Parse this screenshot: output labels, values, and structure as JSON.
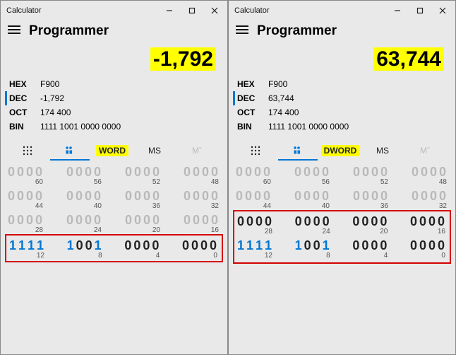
{
  "windows": [
    {
      "title": "Calculator",
      "mode": "Programmer",
      "result": "-1,792",
      "bases": [
        {
          "key": "HEX",
          "val": "F900",
          "sel": false
        },
        {
          "key": "DEC",
          "val": "-1,792",
          "sel": true
        },
        {
          "key": "OCT",
          "val": "174 400",
          "sel": false
        },
        {
          "key": "BIN",
          "val": "1111 1001 0000 0000",
          "sel": false
        }
      ],
      "word_label": "WORD",
      "ms_label": "MS",
      "mclear": "Mˇ",
      "rows": [
        {
          "nibbles": [
            {
              "bits": "0000",
              "pos": "60",
              "active": false
            },
            {
              "bits": "0000",
              "pos": "56",
              "active": false
            },
            {
              "bits": "0000",
              "pos": "52",
              "active": false
            },
            {
              "bits": "0000",
              "pos": "48",
              "active": false
            }
          ],
          "box": false
        },
        {
          "nibbles": [
            {
              "bits": "0000",
              "pos": "44",
              "active": false
            },
            {
              "bits": "0000",
              "pos": "40",
              "active": false
            },
            {
              "bits": "0000",
              "pos": "36",
              "active": false
            },
            {
              "bits": "0000",
              "pos": "32",
              "active": false
            }
          ],
          "box": false
        },
        {
          "nibbles": [
            {
              "bits": "0000",
              "pos": "28",
              "active": false
            },
            {
              "bits": "0000",
              "pos": "24",
              "active": false
            },
            {
              "bits": "0000",
              "pos": "20",
              "active": false
            },
            {
              "bits": "0000",
              "pos": "16",
              "active": false
            }
          ],
          "box": false
        },
        {
          "nibbles": [
            {
              "bits": "1111",
              "pos": "12",
              "active": true
            },
            {
              "bits": "1001",
              "pos": "8",
              "active": true
            },
            {
              "bits": "0000",
              "pos": "4",
              "active": true
            },
            {
              "bits": "0000",
              "pos": "0",
              "active": true
            }
          ],
          "box": true
        }
      ],
      "dbl_box": false
    },
    {
      "title": "Calculator",
      "mode": "Programmer",
      "result": "63,744",
      "bases": [
        {
          "key": "HEX",
          "val": "F900",
          "sel": false
        },
        {
          "key": "DEC",
          "val": "63,744",
          "sel": true
        },
        {
          "key": "OCT",
          "val": "174 400",
          "sel": false
        },
        {
          "key": "BIN",
          "val": "1111 1001 0000 0000",
          "sel": false
        }
      ],
      "word_label": "DWORD",
      "ms_label": "MS",
      "mclear": "Mˇ",
      "rows": [
        {
          "nibbles": [
            {
              "bits": "0000",
              "pos": "60",
              "active": false
            },
            {
              "bits": "0000",
              "pos": "56",
              "active": false
            },
            {
              "bits": "0000",
              "pos": "52",
              "active": false
            },
            {
              "bits": "0000",
              "pos": "48",
              "active": false
            }
          ],
          "box": false
        },
        {
          "nibbles": [
            {
              "bits": "0000",
              "pos": "44",
              "active": false
            },
            {
              "bits": "0000",
              "pos": "40",
              "active": false
            },
            {
              "bits": "0000",
              "pos": "36",
              "active": false
            },
            {
              "bits": "0000",
              "pos": "32",
              "active": false
            }
          ],
          "box": false
        },
        {
          "nibbles": [
            {
              "bits": "0000",
              "pos": "28",
              "active": true
            },
            {
              "bits": "0000",
              "pos": "24",
              "active": true
            },
            {
              "bits": "0000",
              "pos": "20",
              "active": true
            },
            {
              "bits": "0000",
              "pos": "16",
              "active": true
            }
          ],
          "box": false
        },
        {
          "nibbles": [
            {
              "bits": "1111",
              "pos": "12",
              "active": true
            },
            {
              "bits": "1001",
              "pos": "8",
              "active": true
            },
            {
              "bits": "0000",
              "pos": "4",
              "active": true
            },
            {
              "bits": "0000",
              "pos": "0",
              "active": true
            }
          ],
          "box": false
        }
      ],
      "dbl_box": true
    }
  ]
}
